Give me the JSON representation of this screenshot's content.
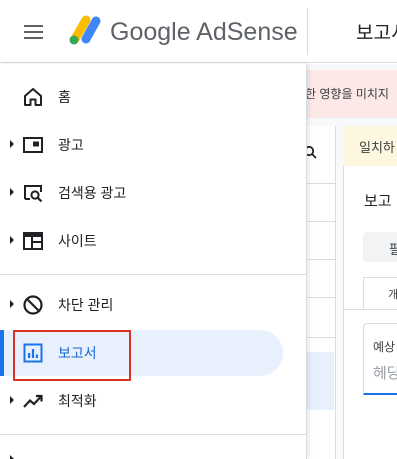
{
  "topbar": {
    "menu_icon": "hamburger-menu-icon",
    "brand": "Google AdSense",
    "page_title": "보고서"
  },
  "background": {
    "alert_text": "…한 영향을 미치지",
    "match_text": "일치하",
    "panel_title": "보고",
    "filter_label": "필",
    "tab_label": "개",
    "card_label": "예상",
    "card_value": "헤당"
  },
  "nav": {
    "items": [
      {
        "label": "홈",
        "icon": "home-icon",
        "expandable": false
      },
      {
        "label": "광고",
        "icon": "ads-icon",
        "expandable": true
      },
      {
        "label": "검색용 광고",
        "icon": "search-ads-icon",
        "expandable": true
      },
      {
        "label": "사이트",
        "icon": "sites-icon",
        "expandable": true
      },
      {
        "label": "차단 관리",
        "icon": "block-icon",
        "expandable": true
      },
      {
        "label": "보고서",
        "icon": "reports-icon",
        "expandable": false,
        "active": true
      },
      {
        "label": "최적화",
        "icon": "optimization-icon",
        "expandable": true
      }
    ]
  },
  "colors": {
    "accent": "#1a73e8",
    "active_bg": "#e8f0fe",
    "highlight_box": "#d93025",
    "alert_bg": "#fce8e6",
    "match_bg": "#fef7e0"
  }
}
